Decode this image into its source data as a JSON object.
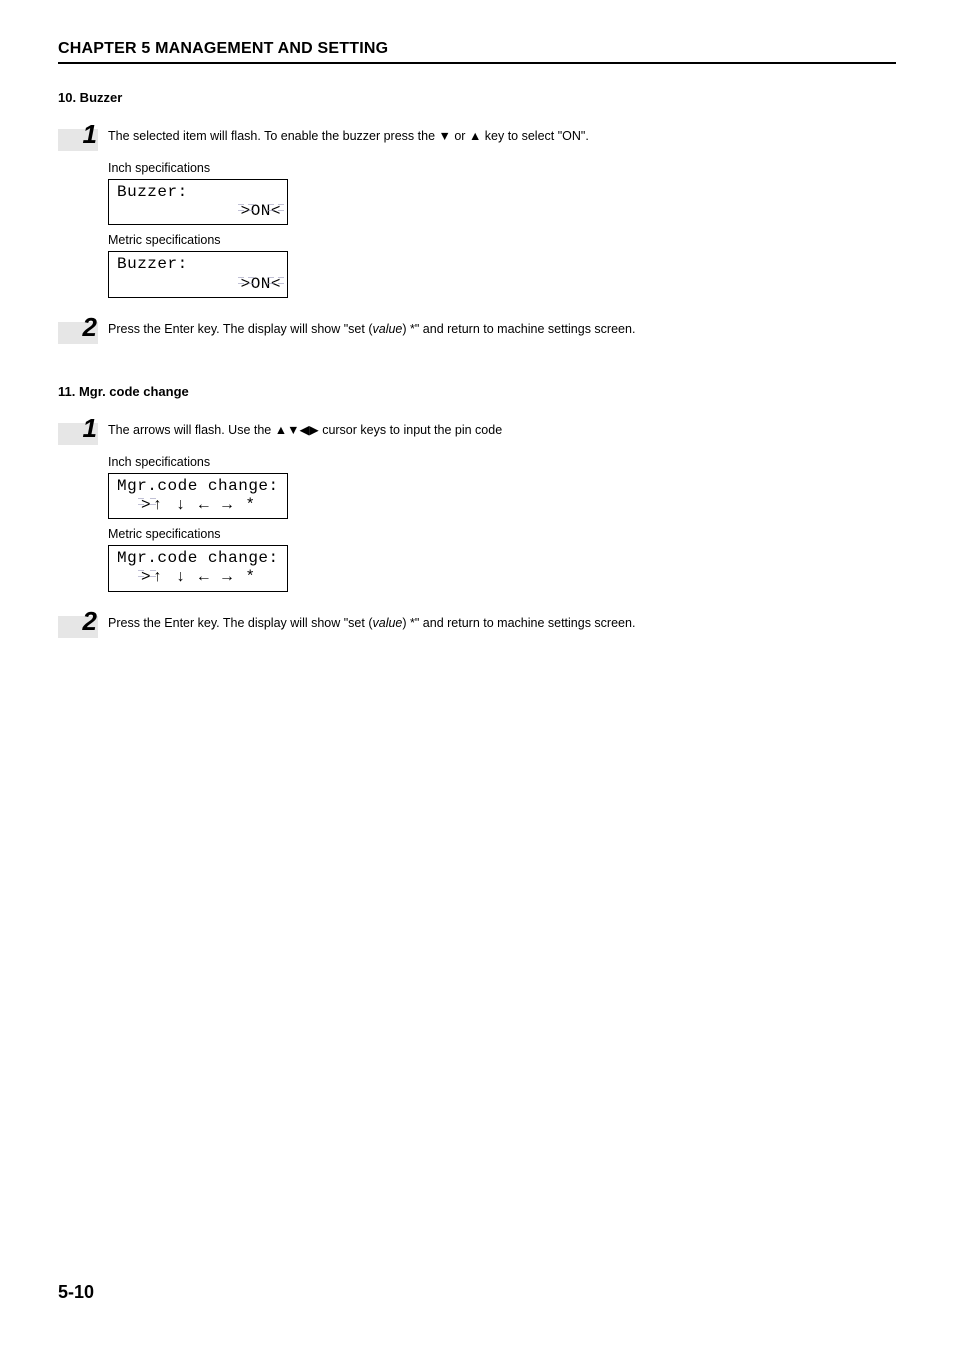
{
  "chapter_title": "CHAPTER 5  MANAGEMENT AND SETTING",
  "section10": {
    "heading": "10. Buzzer",
    "step1": {
      "num": "1",
      "text_before": "The selected item will flash. To enable the buzzer press the ",
      "key1": "▼",
      "or": " or ",
      "key2": "▲",
      "text_after": " key to select \"ON\"."
    },
    "inch_label": "Inch specifications",
    "lcd_inch": {
      "line1": "Buzzer:",
      "line2": "ON"
    },
    "metric_label": "Metric specifications",
    "lcd_metric": {
      "line1": "Buzzer:",
      "line2": "ON"
    },
    "step2": {
      "num": "2",
      "text_before": "Press the Enter key. The display will show \"set (",
      "italic": "value",
      "text_after": ") *\" and return to machine settings screen."
    }
  },
  "section11": {
    "heading": "11. Mgr. code change",
    "step1": {
      "num": "1",
      "text_before": "The arrows will flash. Use the ",
      "keys": "▲▼◀▶",
      "text_after": " cursor keys to input the pin code"
    },
    "inch_label": "Inch specifications",
    "lcd_inch": {
      "line1": "Mgr.code change:",
      "line2": "↑ ↓ ← →  *"
    },
    "metric_label": "Metric specifications",
    "lcd_metric": {
      "line1": "Mgr.code change:",
      "line2": "↑ ↓ ← →  *"
    },
    "step2": {
      "num": "2",
      "text_before": "Press the Enter key. The display will show \"set (",
      "italic": "value",
      "text_after": ") *\" and return to machine settings screen."
    }
  },
  "page_number": "5-10"
}
